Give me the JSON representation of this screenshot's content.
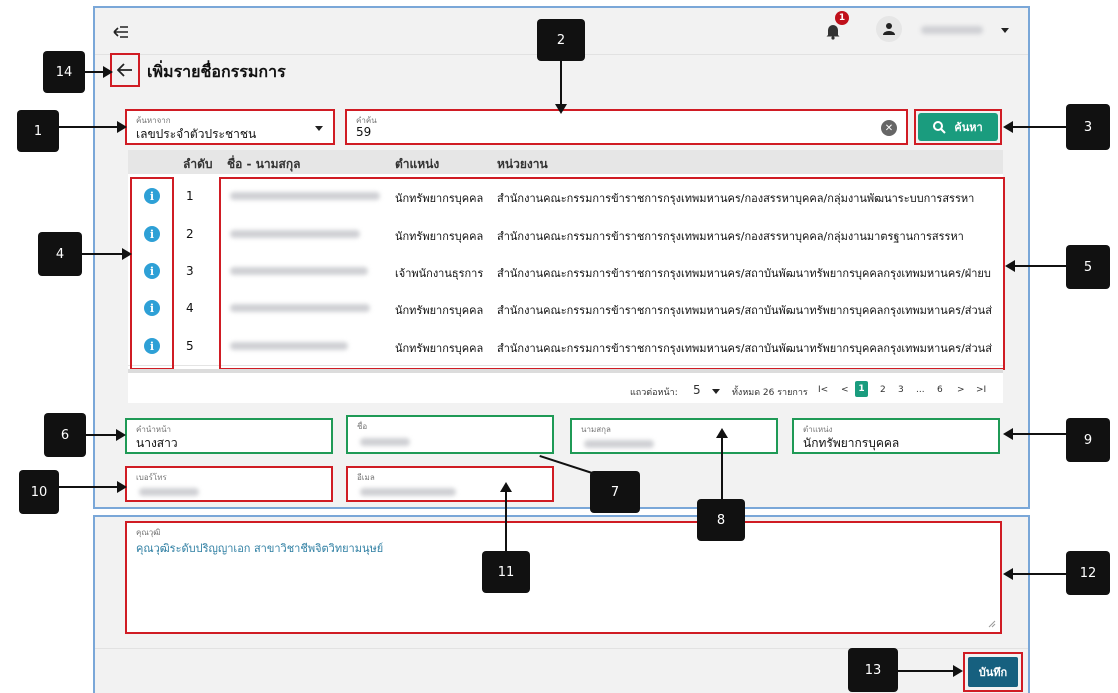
{
  "header": {
    "collapse_icon": "collapse-menu-icon",
    "notification_count": "1",
    "user_menu_icon": "chevron-down-icon"
  },
  "page": {
    "title": "เพิ่มรายชื่อกรรมการ"
  },
  "search": {
    "filter_label": "ค้นหาจาก",
    "filter_value": "เลขประจำตัวประชาชน",
    "keyword_label": "คำค้น",
    "keyword_value": "59",
    "button_label": "ค้นหา"
  },
  "table": {
    "headers": {
      "no": "ลำดับ",
      "name": "ชื่อ - นามสกุล",
      "position": "ตำแหน่ง",
      "unit": "หน่วยงาน"
    },
    "rows": [
      {
        "no": "1",
        "position": "นักทรัพยากรบุคคล",
        "unit": "สำนักงานคณะกรรมการข้าราชการกรุงเทพมหานคร/กองสรรหาบุคคล/กลุ่มงานพัฒนาระบบการสรรหา"
      },
      {
        "no": "2",
        "position": "นักทรัพยากรบุคคล",
        "unit": "สำนักงานคณะกรรมการข้าราชการกรุงเทพมหานคร/กองสรรหาบุคคล/กลุ่มงานมาตรฐานการสรรหา"
      },
      {
        "no": "3",
        "position": "เจ้าพนักงานธุรการ",
        "unit": "สำนักงานคณะกรรมการข้าราชการกรุงเทพมหานคร/สถาบันพัฒนาทรัพยากรบุคคลกรุงเทพมหานคร/ฝ่ายบ"
      },
      {
        "no": "4",
        "position": "นักทรัพยากรบุคคล",
        "unit": "สำนักงานคณะกรรมการข้าราชการกรุงเทพมหานคร/สถาบันพัฒนาทรัพยากรบุคคลกรุงเทพมหานคร/ส่วนส่"
      },
      {
        "no": "5",
        "position": "นักทรัพยากรบุคคล",
        "unit": "สำนักงานคณะกรรมการข้าราชการกรุงเทพมหานคร/สถาบันพัฒนาทรัพยากรบุคคลกรุงเทพมหานคร/ส่วนส่"
      }
    ]
  },
  "pagination": {
    "rows_per_page_label": "แถวต่อหน้า:",
    "rows_per_page": "5",
    "total_label": "ทั้งหมด 26 รายการ",
    "first": "I<",
    "prev": "<",
    "p1": "1",
    "p2": "2",
    "p3": "3",
    "ellipsis": "...",
    "p6": "6",
    "next": ">",
    "last": ">I"
  },
  "form": {
    "prefix_label": "คำนำหน้า",
    "prefix_value": "นางสาว",
    "firstname_label": "ชื่อ",
    "lastname_label": "นามสกุล",
    "position_label": "ตำแหน่ง",
    "position_value": "นักทรัพยากรบุคคล",
    "phone_label": "เบอร์โทร",
    "email_label": "อีเมล",
    "qualification_label": "คุณวุฒิ",
    "qualification_value": "คุณวุฒิระดับปริญญาเอก สาขาวิชาชีพจิตวิทยามนุษย์"
  },
  "save_button": "บันทึก",
  "callouts": [
    "1",
    "2",
    "3",
    "4",
    "5",
    "6",
    "7",
    "8",
    "9",
    "10",
    "11",
    "12",
    "13",
    "14"
  ],
  "colors": {
    "accent": "#1a9c7e",
    "save": "#16607f",
    "red_marker": "#d01c24",
    "green_marker": "#1f9a56",
    "info": "#2ea0d6"
  }
}
